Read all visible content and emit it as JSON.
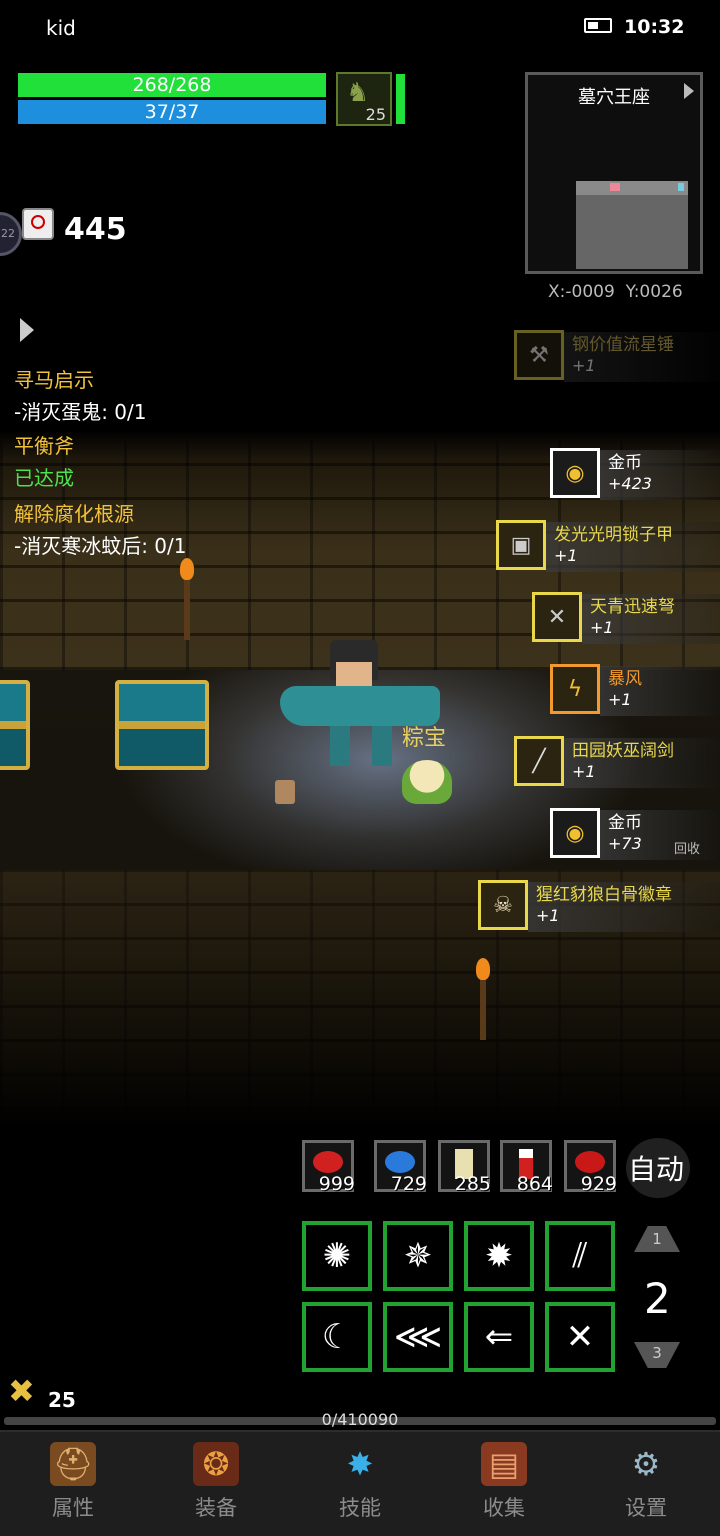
{
  "status": {
    "carrier": "kid",
    "time": "10:32"
  },
  "player": {
    "hp": "268/268",
    "mp": "37/37",
    "pet_level": "25"
  },
  "timer": {
    "count": "445",
    "side_badge": "22"
  },
  "minimap": {
    "title": "墓穴王座",
    "coords": "X:-0009  Y:0026"
  },
  "quests": [
    {
      "title": "寻马启示",
      "line": "-消灭蛋鬼: 0/1"
    },
    {
      "title": "平衡斧",
      "line": "已达成"
    },
    {
      "title": "解除腐化根源",
      "line": "-消灭寒冰蚊后: 0/1"
    }
  ],
  "loot": [
    {
      "name": "钢价值流星锤",
      "count": "+1",
      "icon": "mace-icon",
      "faded": true
    },
    {
      "name": "金币",
      "count": "+423",
      "icon": "gold-coin-icon"
    },
    {
      "name": "发光光明锁子甲",
      "count": "+1",
      "icon": "armor-icon"
    },
    {
      "name": "天青迅速弩",
      "count": "+1",
      "icon": "crossbow-icon"
    },
    {
      "name": "暴风",
      "count": "+1",
      "icon": "storm-icon"
    },
    {
      "name": "田园妖巫阔剑",
      "count": "+1",
      "icon": "sword-icon"
    },
    {
      "name": "金币",
      "count": "+73",
      "icon": "gold-coin-icon",
      "note": "回收"
    },
    {
      "name": "猩红豺狼白骨徽章",
      "count": "+1",
      "icon": "badge-icon"
    }
  ],
  "pet_name": "粽宝",
  "potions": [
    "999",
    "729",
    "285",
    "864",
    "929"
  ],
  "auto_label": "自动",
  "skill_page": {
    "current": "2",
    "up": "1",
    "down": "3"
  },
  "level_badge": "25",
  "exp": "0/410090",
  "tabs": [
    {
      "label": "属性",
      "icon": "helmet-icon"
    },
    {
      "label": "装备",
      "icon": "bag-icon"
    },
    {
      "label": "技能",
      "icon": "skill-gem-icon"
    },
    {
      "label": "收集",
      "icon": "book-icon"
    },
    {
      "label": "设置",
      "icon": "gear-icon"
    }
  ],
  "colors": {
    "hp": "#22e03a",
    "mp": "#1e8fdc",
    "quest_title": "#f2c23a",
    "done": "#4fe04f",
    "skill_border": "#22a230"
  }
}
